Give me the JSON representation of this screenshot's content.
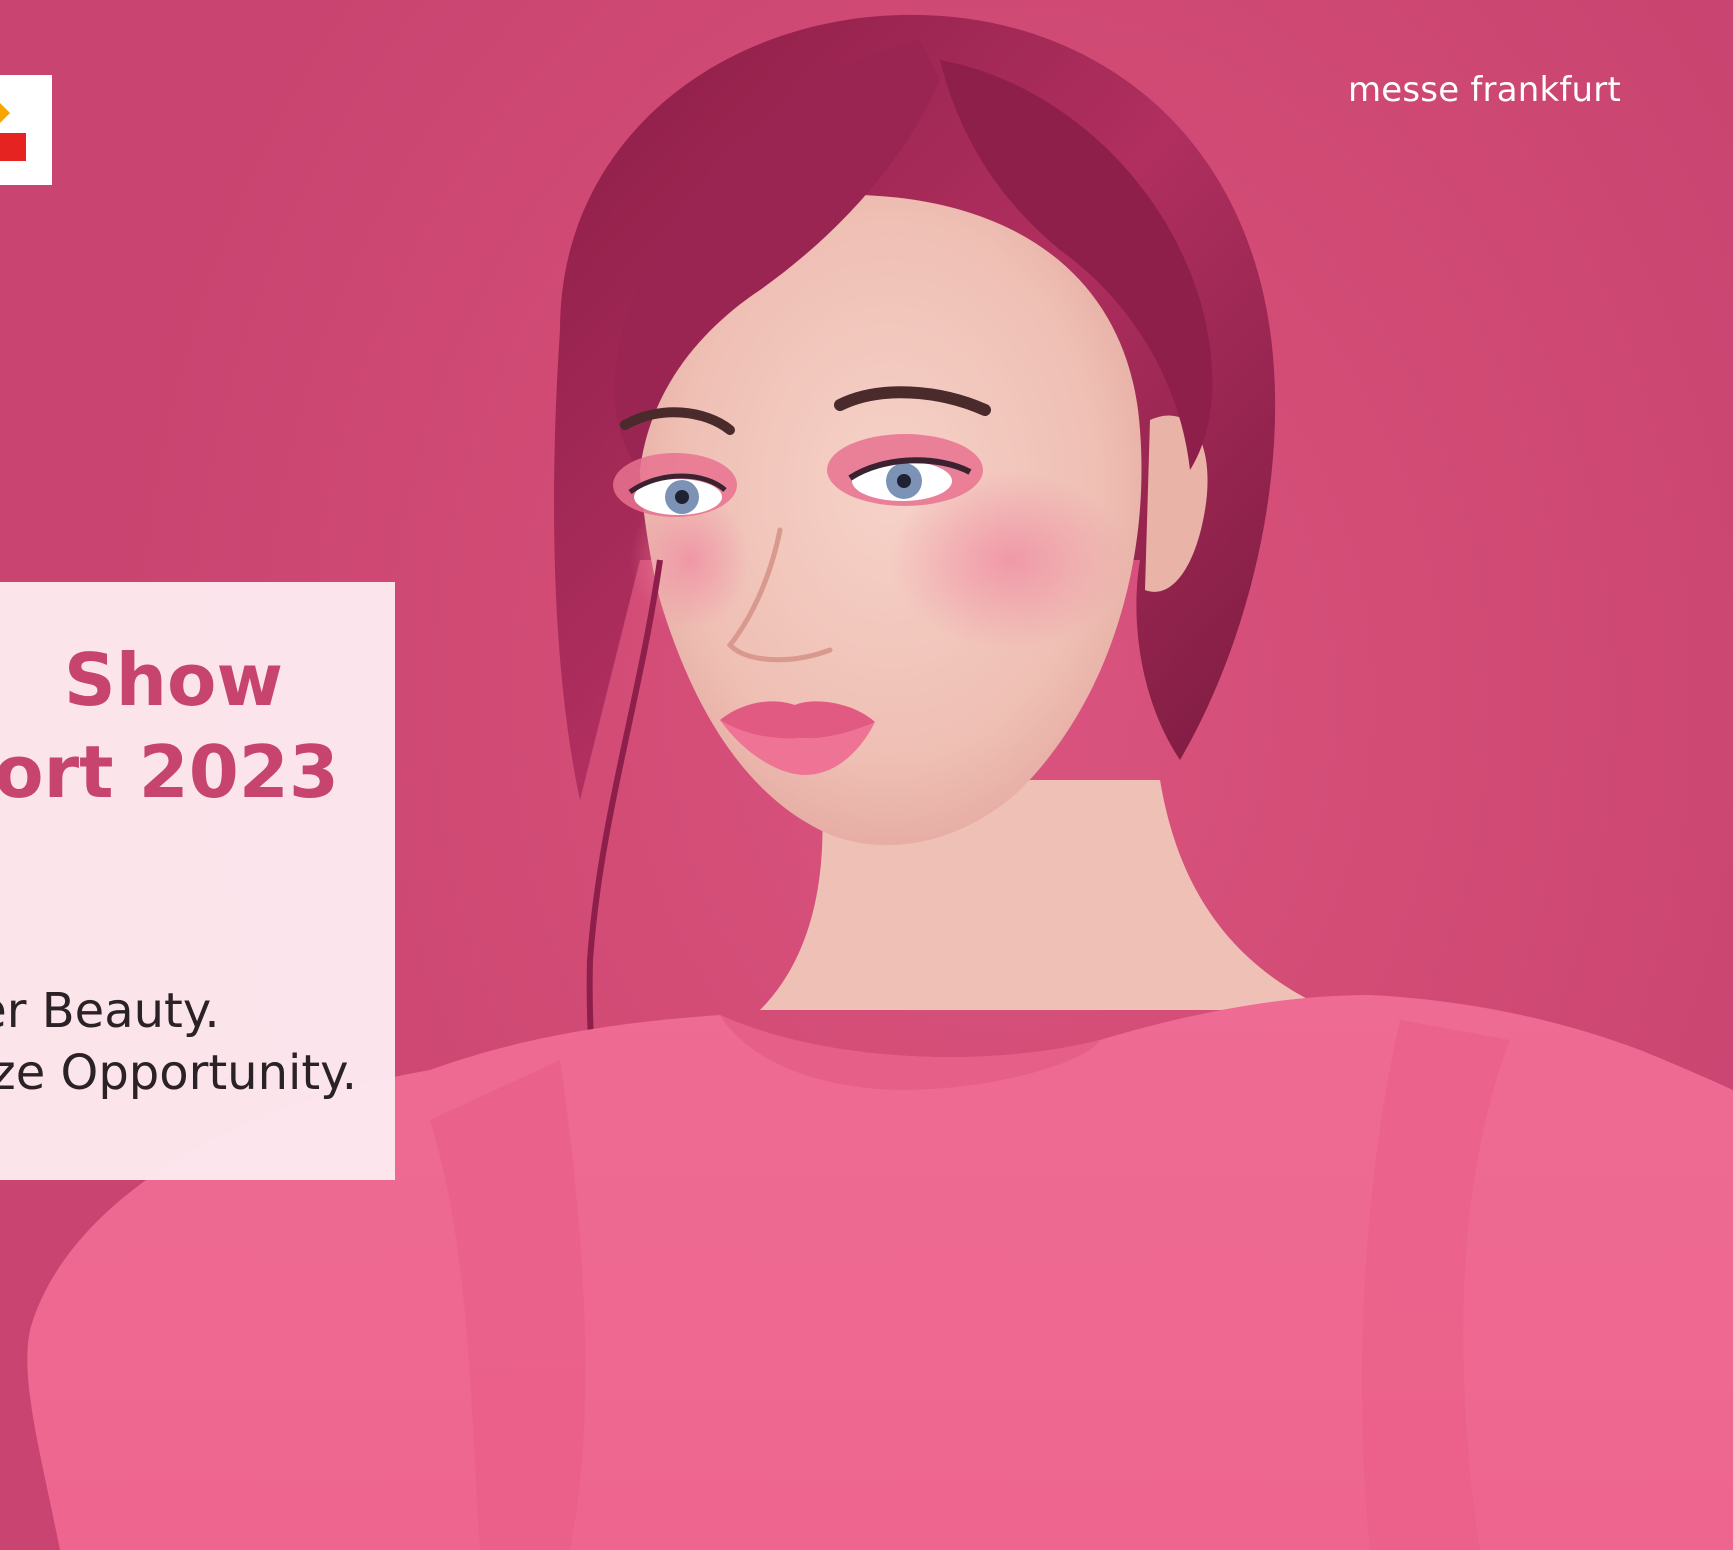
{
  "brand": {
    "name": "messe frankfurt",
    "colors": {
      "background": "#d44d78",
      "title": "#c7446e",
      "panel": "#fde9f0",
      "logo_red": "#e52421",
      "logo_yellow": "#f7a600"
    }
  },
  "cover": {
    "title_line_1": "Show",
    "title_line_2": "ort 2023",
    "tagline_line_1": "er Beauty.",
    "tagline_line_2": "ize Opportunity."
  },
  "logo": {
    "icon": "messe-frankfurt-logo-mark"
  }
}
